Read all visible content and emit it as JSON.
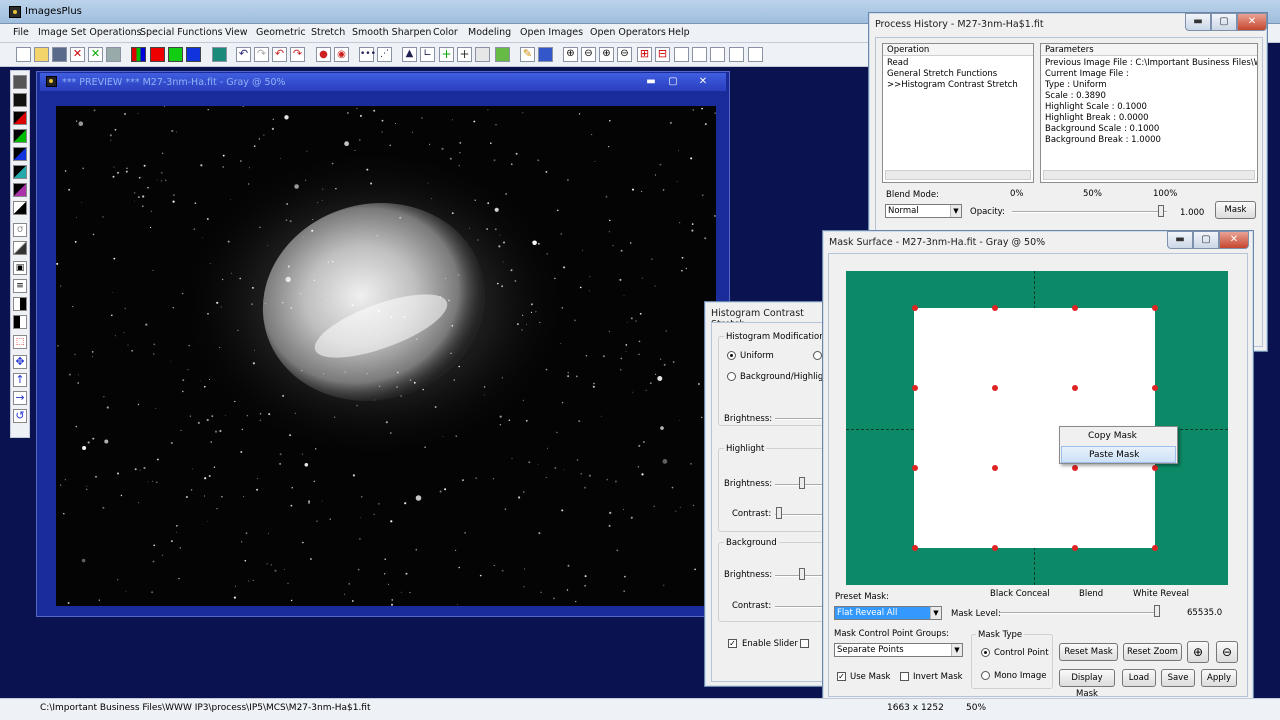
{
  "app": {
    "title": "ImagesPlus"
  },
  "menu": [
    "File",
    "Image Set Operations",
    "Special Functions",
    "View",
    "Geometric",
    "Stretch",
    "Smooth Sharpen",
    "Color",
    "Modeling",
    "Open Images",
    "Open Operators",
    "Help"
  ],
  "preview": {
    "title": "*** PREVIEW *** M27-3nm-Ha.fit - Gray @ 50%"
  },
  "status": {
    "path": "C:\\Important Business Files\\WWW IP3\\process\\IP5\\MCS\\M27-3nm-Ha$1.fit",
    "dims": "1663 x 1252",
    "zoom": "50%"
  },
  "process_history": {
    "title": "Process History - M27-3nm-Ha$1.fit",
    "operation_header": "Operation",
    "parameters_header": "Parameters",
    "operations": [
      "Read",
      "General Stretch Functions",
      ">>Histogram Contrast Stretch"
    ],
    "parameters": [
      "Previous Image File : C:\\Important Business Files\\WWW",
      "Current Image File :",
      "Type : Uniform",
      "Scale : 0.3890",
      "Highlight Scale : 0.1000",
      "Highlight Break : 0.0000",
      "Background Scale : 0.1000",
      "Background Break : 1.0000"
    ],
    "blend_mode_label": "Blend Mode:",
    "blend_mode": "Normal",
    "opacity_label": "Opacity:",
    "opacity_ticks": [
      "0%",
      "50%",
      "100%"
    ],
    "opacity_value": "1.000",
    "mask_button": "Mask"
  },
  "histogram": {
    "title": "Histogram Contrast Stretch",
    "mod_type_label": "Histogram Modification Ty",
    "radio_uniform": "Uniform",
    "radio_bh": "Background/Highligh",
    "brightness_label": "Brightness:",
    "highlight_group": "Highlight",
    "highlight_brightness": "Brightness:",
    "highlight_contrast": "Contrast:",
    "background_group": "Background",
    "background_brightness": "Brightness:",
    "background_contrast": "Contrast:",
    "enable_slider": "Enable Slider"
  },
  "mask_surface": {
    "title": "Mask Surface - M27-3nm-Ha.fit - Gray @ 50%",
    "context_menu": [
      "Copy Mask",
      "Paste Mask"
    ],
    "preset_label": "Preset Mask:",
    "preset_value": "Flat Reveal All",
    "mask_level_label": "Mask Level:",
    "level_ticks": [
      "Black Conceal",
      "Blend",
      "White Reveal"
    ],
    "level_value": "65535.0",
    "groups_label": "Mask Control Point Groups:",
    "groups_value": "Separate Points",
    "mask_type_label": "Mask Type",
    "mask_type_options": [
      "Control Point",
      "Mono Image"
    ],
    "use_mask": "Use Mask",
    "invert_mask": "Invert Mask",
    "buttons": {
      "reset_mask": "Reset Mask",
      "reset_zoom": "Reset Zoom",
      "display_mask": "Display Mask",
      "load": "Load",
      "save": "Save",
      "apply": "Apply"
    }
  }
}
